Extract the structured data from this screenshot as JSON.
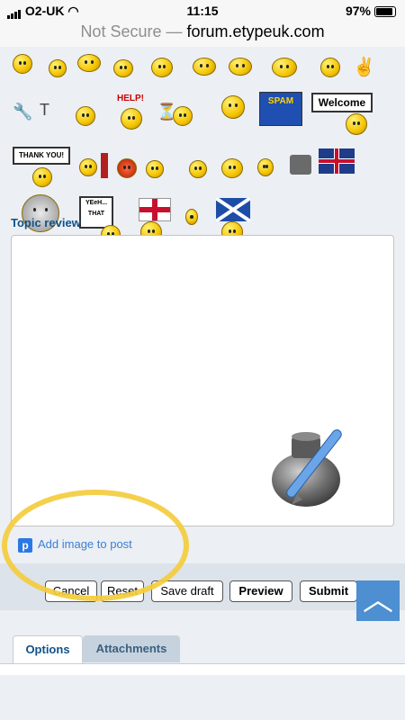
{
  "status_bar": {
    "carrier": "O2-UK",
    "time": "11:15",
    "battery": "97%"
  },
  "url_bar": {
    "security": "Not Secure —",
    "domain": "forum.etypeuk.com"
  },
  "smilies": {
    "help_sign": "HELP!",
    "spam_label": "SPAM",
    "welcome_sign": "Welcome",
    "thankyou_sign": "THANK YOU!",
    "yeah_sign": "YEeH... THAT"
  },
  "topic_review": {
    "title": "Topic review",
    "add_image_label": "Add image to post"
  },
  "buttons": {
    "cancel": "Cancel",
    "reset": "Reset",
    "save_draft": "Save draft",
    "preview": "Preview",
    "submit": "Submit"
  },
  "tabs": {
    "options": "Options",
    "attachments": "Attachments"
  },
  "colors": {
    "highlight_circle": "#f3cc3d",
    "link_blue": "#3a7fd5",
    "heading_blue": "#105289",
    "scroll_button": "#4d8fd1"
  }
}
